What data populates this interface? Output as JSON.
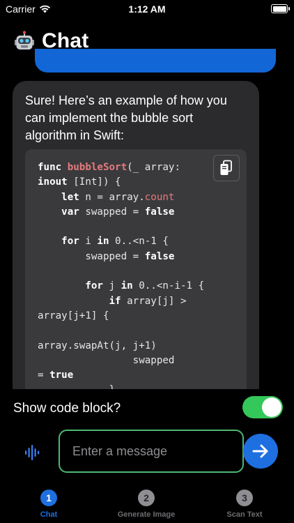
{
  "status_bar": {
    "carrier": "Carrier",
    "time": "1:12 AM"
  },
  "header": {
    "title": "Chat",
    "icon": "robot-icon"
  },
  "assistant_message": {
    "text": "Sure! Here’s an example of how you can implement the bubble sort algorithm in Swift:",
    "code_lines": [
      [
        {
          "t": "func ",
          "c": "kw"
        },
        {
          "t": "bubbleSort",
          "c": "fn"
        },
        {
          "t": "(_ array:",
          "c": ""
        }
      ],
      [
        {
          "t": "inout",
          "c": "kw"
        },
        {
          "t": " [Int]) {",
          "c": ""
        }
      ],
      [
        {
          "t": "    ",
          "c": ""
        },
        {
          "t": "let",
          "c": "kw"
        },
        {
          "t": " n = array.",
          "c": ""
        },
        {
          "t": "count",
          "c": "prop"
        }
      ],
      [
        {
          "t": "    ",
          "c": ""
        },
        {
          "t": "var",
          "c": "kw"
        },
        {
          "t": " swapped = ",
          "c": ""
        },
        {
          "t": "false",
          "c": "kw"
        }
      ],
      [
        {
          "t": "",
          "c": ""
        }
      ],
      [
        {
          "t": "    ",
          "c": ""
        },
        {
          "t": "for",
          "c": "kw"
        },
        {
          "t": " i ",
          "c": ""
        },
        {
          "t": "in",
          "c": "kw"
        },
        {
          "t": " 0..<n-1 {",
          "c": ""
        }
      ],
      [
        {
          "t": "        swapped = ",
          "c": ""
        },
        {
          "t": "false",
          "c": "kw"
        }
      ],
      [
        {
          "t": "",
          "c": ""
        }
      ],
      [
        {
          "t": "        ",
          "c": ""
        },
        {
          "t": "for",
          "c": "kw"
        },
        {
          "t": " j ",
          "c": ""
        },
        {
          "t": "in",
          "c": "kw"
        },
        {
          "t": " 0..<n-i-1 {",
          "c": ""
        }
      ],
      [
        {
          "t": "            ",
          "c": ""
        },
        {
          "t": "if",
          "c": "kw"
        },
        {
          "t": " array[j] >",
          "c": ""
        }
      ],
      [
        {
          "t": "array[j+1] {",
          "c": ""
        }
      ],
      [
        {
          "t": "",
          "c": ""
        }
      ],
      [
        {
          "t": "array.swapAt(j, j+1)",
          "c": ""
        }
      ],
      [
        {
          "t": "                swapped",
          "c": ""
        }
      ],
      [
        {
          "t": "= ",
          "c": ""
        },
        {
          "t": "true",
          "c": "kw"
        }
      ],
      [
        {
          "t": "            }",
          "c": ""
        }
      ]
    ]
  },
  "toggle": {
    "label": "Show code block?",
    "on": true
  },
  "input": {
    "placeholder": "Enter a message"
  },
  "tabs": [
    {
      "number": "1",
      "label": "Chat",
      "active": true
    },
    {
      "number": "2",
      "label": "Generate Image",
      "active": false
    },
    {
      "number": "3",
      "label": "Scan Text",
      "active": false
    }
  ],
  "colors": {
    "accent": "#1e6fe0",
    "toggle_on": "#34c759",
    "bubble": "#2b2b2e",
    "code_bg": "#3a3a3d"
  }
}
